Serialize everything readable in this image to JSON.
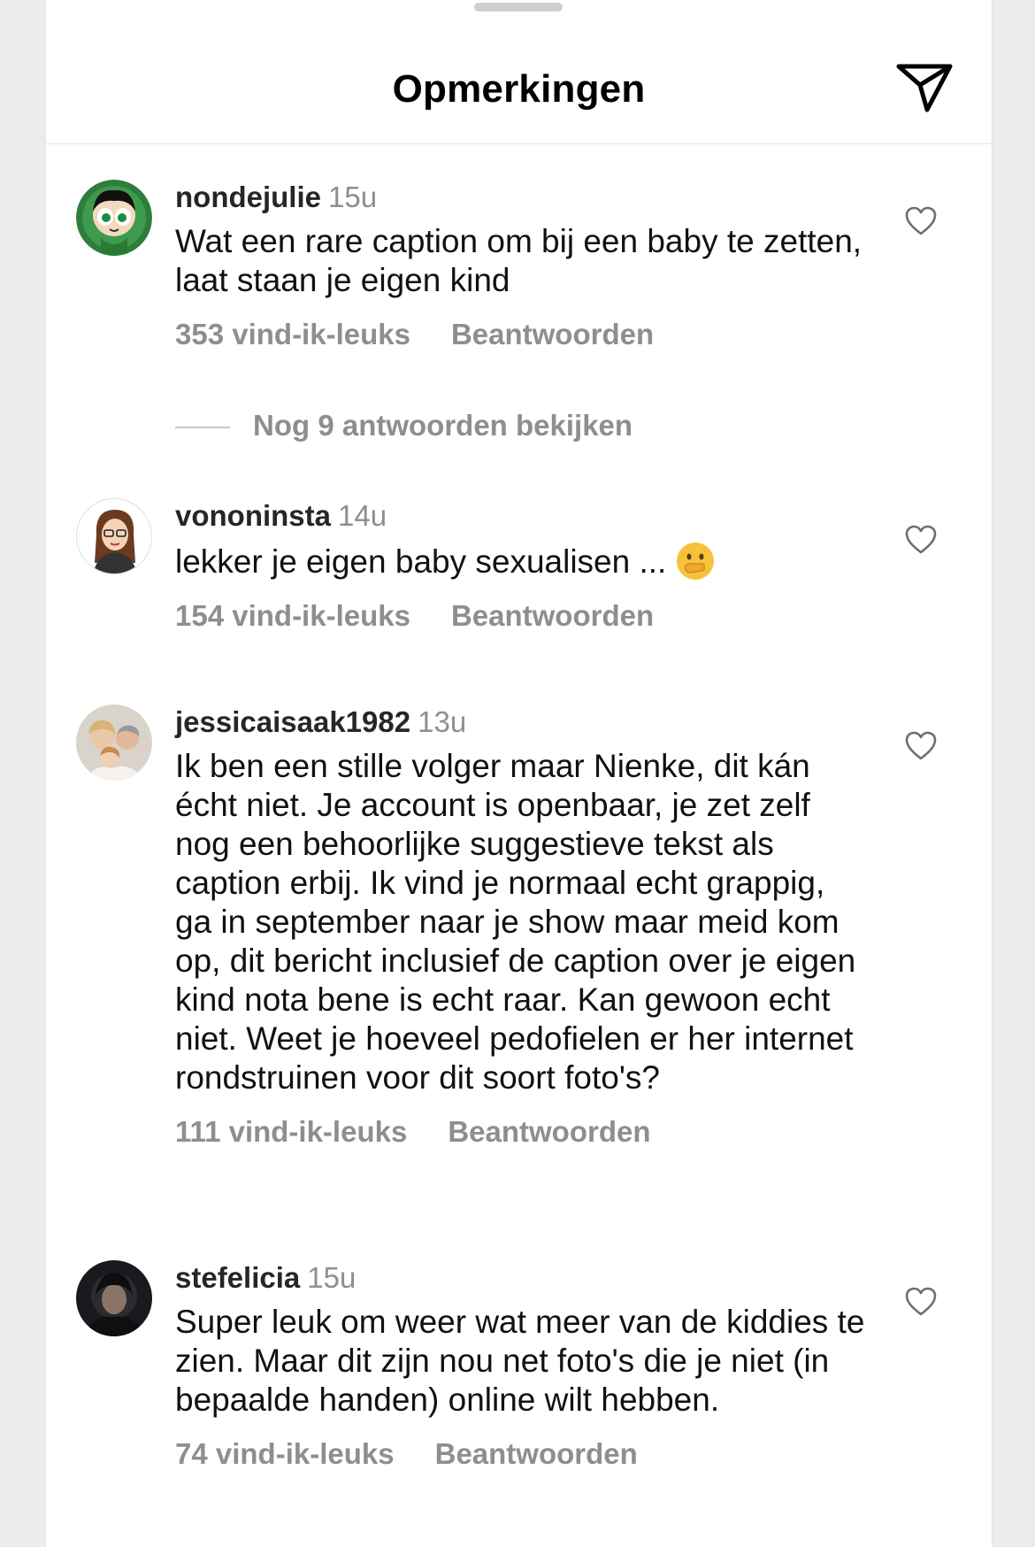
{
  "header": {
    "title": "Opmerkingen"
  },
  "comments": [
    {
      "username": "nondejulie",
      "time": "15u",
      "text": "Wat een rare caption om bij een baby te zetten, laat staan je eigen kind",
      "likes": "353 vind-ik-leuks",
      "reply": "Beantwoorden"
    },
    {
      "username": "vononinsta",
      "time": "14u",
      "text": "lekker je eigen baby sexualisen ...",
      "likes": "154 vind-ik-leuks",
      "reply": "Beantwoorden"
    },
    {
      "username": "jessicaisaak1982",
      "time": "13u",
      "text": "Ik ben een stille volger maar Nienke, dit kán écht niet. Je account is openbaar, je zet zelf nog een behoorlijke suggestieve tekst als caption erbij. Ik vind je normaal echt grappig, ga in september naar je show maar meid kom op, dit bericht inclusief de caption over je eigen kind nota bene is echt raar. Kan gewoon echt niet. Weet je hoeveel pedofielen er her internet rondstruinen voor dit soort foto's?",
      "likes": "111 vind-ik-leuks",
      "reply": "Beantwoorden"
    },
    {
      "username": "stefelicia",
      "time": "15u",
      "text": "Super leuk om weer wat meer van de kiddies te zien. Maar dit zijn nou net foto's die je niet (in bepaalde handen) online wilt hebben.",
      "likes": "74 vind-ik-leuks",
      "reply": "Beantwoorden"
    }
  ],
  "view_replies": "Nog 9 antwoorden bekijken",
  "icons": {
    "share": "paper-plane-icon",
    "like": "heart-icon",
    "emoji": "hand-over-mouth-emoji"
  },
  "colors": {
    "secondary_text": "#8e8e8e",
    "primary_text": "#111111"
  }
}
